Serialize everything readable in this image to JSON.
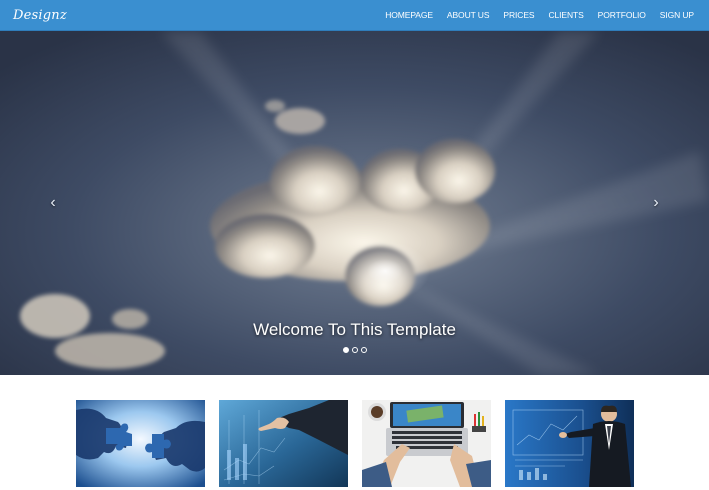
{
  "navbar": {
    "brand": "Designz",
    "items": [
      {
        "label": "HOMEPAGE"
      },
      {
        "label": "ABOUT US"
      },
      {
        "label": "PRICES"
      },
      {
        "label": "CLIENTS"
      },
      {
        "label": "PORTFOLIO"
      },
      {
        "label": "SIGN UP"
      }
    ],
    "color": "#3a8fd0"
  },
  "hero": {
    "caption": "Welcome To This Template",
    "prev_icon": "‹",
    "next_icon": "›",
    "slides_total": 3,
    "active_slide": 1
  },
  "thumbnails": [
    {
      "subject": "puzzle-pieces-hands"
    },
    {
      "subject": "hand-touching-chart-screen"
    },
    {
      "subject": "laptop-with-money-on-desk"
    },
    {
      "subject": "businessman-with-virtual-screen"
    }
  ]
}
